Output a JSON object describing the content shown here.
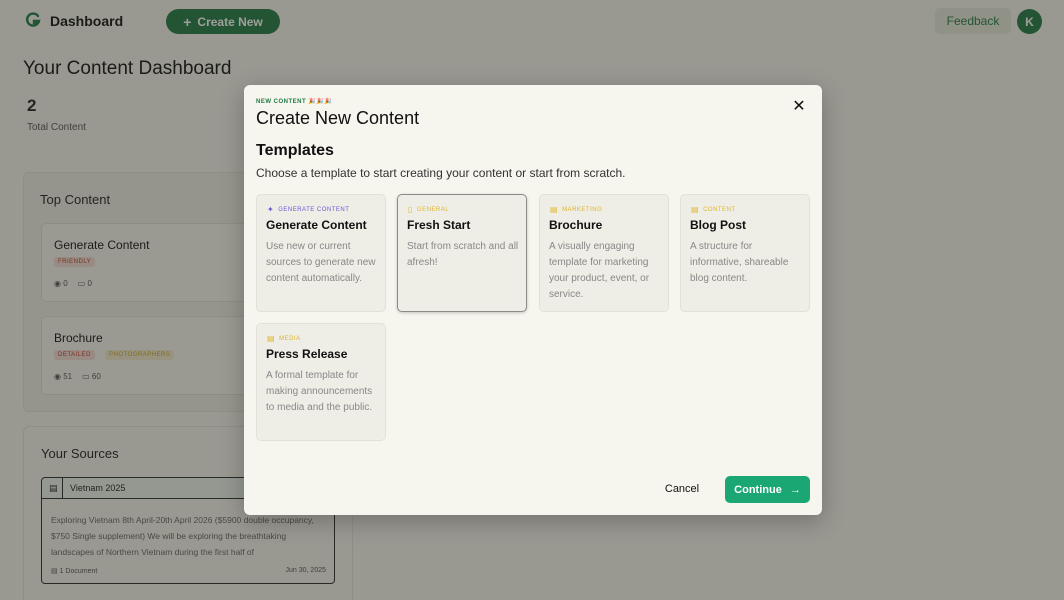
{
  "header": {
    "brand": "Dashboard",
    "create_button": "Create New",
    "feedback_button": "Feedback",
    "avatar_initial": "K"
  },
  "dashboard": {
    "title": "Your Content Dashboard",
    "total_count": "2",
    "total_label": "Total Content",
    "top_content_title": "Top Content",
    "top_items": [
      {
        "name": "Generate Content",
        "tags": [
          "FRIENDLY"
        ],
        "views": "0",
        "comments": "0"
      },
      {
        "name": "Brochure",
        "tags": [
          "DETAILED",
          "PHOTOGRAPHERS"
        ],
        "views": "51",
        "comments": "60"
      }
    ],
    "sources_title": "Your Sources",
    "source": {
      "title": "Vietnam 2025",
      "body": "Exploring Vietnam 8th April-20th April 2026 ($5900 double occupancy, $750 Single supplement) We will be exploring the breathtaking landscapes of Northern Vietnam during the first half of",
      "documents": "1 Document",
      "date": "Jun 30, 2025"
    }
  },
  "modal": {
    "eyebrow": "NEW CONTENT 🎉🎉🎉",
    "title": "Create New Content",
    "section_title": "Templates",
    "section_subtitle": "Choose a template to start creating your content or start from scratch.",
    "templates": [
      {
        "category": "GENERATE CONTENT",
        "name": "Generate Content",
        "description": "Use new or current sources to generate new content automatically.",
        "color": "#6b5bd6",
        "icon": "sparkle-icon"
      },
      {
        "category": "GENERAL",
        "name": "Fresh Start",
        "description": "Start from scratch and all afresh!",
        "color": "#e0b62b",
        "icon": "document-icon"
      },
      {
        "category": "MARKETING",
        "name": "Brochure",
        "description": "A visually engaging template for marketing your product, event, or service.",
        "color": "#e0b62b",
        "icon": "list-icon"
      },
      {
        "category": "CONTENT",
        "name": "Blog Post",
        "description": "A structure for informative, shareable blog content.",
        "color": "#e0b62b",
        "icon": "list-icon"
      },
      {
        "category": "MEDIA",
        "name": "Press Release",
        "description": "A formal template for making announcements to media and the public.",
        "color": "#e0b62b",
        "icon": "list-icon"
      }
    ],
    "cancel_button": "Cancel",
    "continue_button": "Continue"
  },
  "colors": {
    "brand_green": "#1f7a45",
    "accent_green": "#1aa774",
    "background": "#f6f5ee"
  }
}
